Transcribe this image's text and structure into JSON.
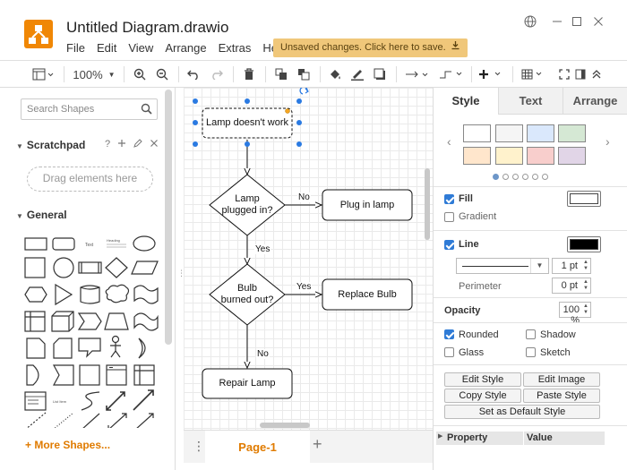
{
  "app": {
    "title": "Untitled Diagram.drawio",
    "menu": [
      "File",
      "Edit",
      "View",
      "Arrange",
      "Extras",
      "Help"
    ],
    "unsaved_notice": "Unsaved changes. Click here to save."
  },
  "toolbar": {
    "zoom": "100%"
  },
  "sidebar": {
    "search_placeholder": "Search Shapes",
    "scratchpad_title": "Scratchpad",
    "scratchpad_help": "?",
    "dropzone_text": "Drag elements here",
    "general_title": "General",
    "more_shapes": "+ More Shapes..."
  },
  "diagram": {
    "nodes": {
      "start": "Lamp doesn't work",
      "decision1": "Lamp\nplugged in?",
      "plug": "Plug in lamp",
      "decision2": "Bulb\nburned out?",
      "replace": "Replace Bulb",
      "repair": "Repair Lamp"
    },
    "edges": {
      "no1": "No",
      "yes1": "Yes",
      "yes2": "Yes",
      "no2": "No"
    }
  },
  "pages": {
    "current": "Page-1"
  },
  "format_panel": {
    "tabs": [
      "Style",
      "Text",
      "Arrange"
    ],
    "active_tab": "Style",
    "swatches": [
      "#ffffff",
      "#f5f5f5",
      "#dae8fc",
      "#d5e8d4",
      "#ffe6cc",
      "#fff2cc",
      "#f8cecc",
      "#e1d5e7"
    ],
    "fill_label": "Fill",
    "fill_checked": true,
    "fill_color": "#ffffff",
    "gradient_label": "Gradient",
    "gradient_checked": false,
    "line_label": "Line",
    "line_checked": true,
    "line_color": "#000000",
    "line_width": "1 pt",
    "perimeter_label": "Perimeter",
    "perimeter_value": "0 pt",
    "opacity_label": "Opacity",
    "opacity_value": "100 %",
    "rounded_label": "Rounded",
    "rounded_checked": true,
    "shadow_label": "Shadow",
    "shadow_checked": false,
    "glass_label": "Glass",
    "glass_checked": false,
    "sketch_label": "Sketch",
    "sketch_checked": false,
    "buttons": {
      "edit_style": "Edit Style",
      "edit_image": "Edit Image",
      "copy_style": "Copy Style",
      "paste_style": "Paste Style",
      "set_default": "Set as Default Style"
    },
    "property_header": "Property",
    "value_header": "Value"
  }
}
